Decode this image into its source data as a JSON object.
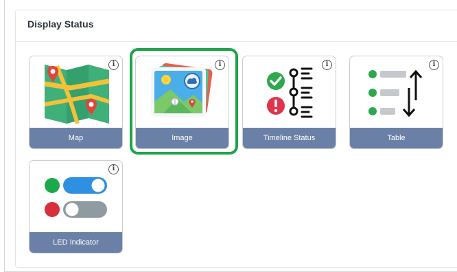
{
  "panel": {
    "title": "Display Status"
  },
  "cards": [
    {
      "label": "Map",
      "icon": "map-icon",
      "selected": false
    },
    {
      "label": "Image",
      "icon": "image-icon",
      "selected": true
    },
    {
      "label": "Timeline Status",
      "icon": "timeline-status-icon",
      "selected": false
    },
    {
      "label": "Table",
      "icon": "table-icon",
      "selected": false
    },
    {
      "label": "LED Indicator",
      "icon": "led-indicator-icon",
      "selected": false
    }
  ],
  "info_icon_glyph": "i",
  "colors": {
    "card_label_bg": "#6b80a6",
    "selected_border": "#1fa34a",
    "card_border": "#c9cdd3"
  }
}
